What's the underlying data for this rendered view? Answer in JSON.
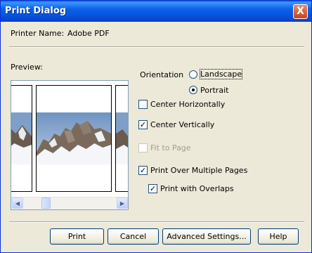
{
  "window": {
    "title": "Print Dialog",
    "close_glyph": "X"
  },
  "printer": {
    "label": "Printer Name:",
    "value": "Adobe PDF"
  },
  "preview": {
    "label": "Preview:",
    "scroll_left_icon": "arrow-left-icon",
    "scroll_right_icon": "arrow-right-icon"
  },
  "orientation": {
    "label": "Orientation",
    "landscape": "Landscape",
    "portrait": "Portrait",
    "selected": "Portrait"
  },
  "options": {
    "center_horizontally": {
      "label": "Center Horizontally",
      "checked": false
    },
    "center_vertically": {
      "label": "Center Vertically",
      "checked": true
    },
    "fit_to_page": {
      "label": "Fit to Page",
      "checked": false,
      "enabled": false
    },
    "print_over_multiple_pages": {
      "label": "Print Over Multiple Pages",
      "checked": true
    },
    "print_with_overlaps": {
      "label": "Print with Overlaps",
      "checked": true
    }
  },
  "buttons": {
    "print": "Print",
    "cancel": "Cancel",
    "advanced": "Advanced Settings...",
    "help": "Help"
  },
  "colors": {
    "titlebar": "#0554e0",
    "dialog_bg": "#ece9d8",
    "sky": "#7ea0c8",
    "snow": "#f4f6fa",
    "rock": "#6b5a4e"
  }
}
